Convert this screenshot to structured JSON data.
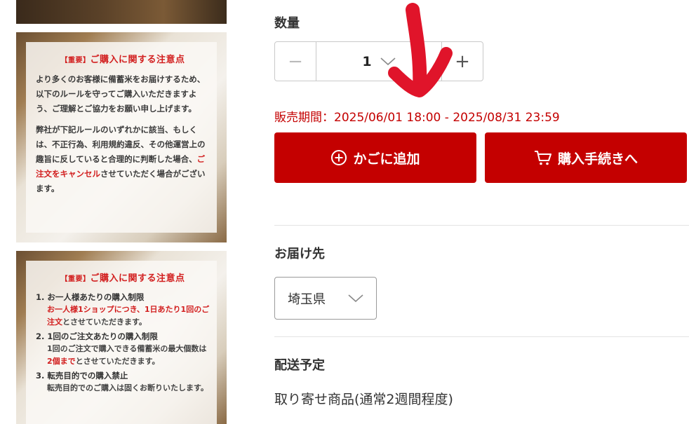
{
  "gallery": {
    "image1": {
      "title_tag": "【重要】",
      "title": "ご購入に関する注意点",
      "para1": "より多くのお客様に備蓄米をお届けするため、以下のルールを守ってご購入いただきますよう、ご理解とご協力をお願い申し上げます。",
      "para2_pre": "弊社が下記ルールのいずれかに該当、もしくは、不正行為、利用規約違反、その他運営上の趣旨に反していると合理的に判断した場合、",
      "para2_red": "ご注文をキャンセル",
      "para2_post": "させていただく場合がございます。"
    },
    "image2": {
      "title_tag": "【重要】",
      "title": "ご購入に関する注意点",
      "rules": [
        {
          "head": "1. お一人様あたりの購入制限",
          "body_red": "お一人様1ショップにつき、1日あたり1回のご注文",
          "body_post": "とさせていただきます。"
        },
        {
          "head": "2. 1回のご注文あたりの購入制限",
          "body_pre": "1回のご注文で購入できる備蓄米の最大個数は",
          "body_red": "2個まで",
          "body_post": "とさせていただきます。"
        },
        {
          "head": "3. 転売目的での購入禁止",
          "body_pre": "転売目的でのご購入は固くお断りいたします。"
        }
      ]
    }
  },
  "quantity": {
    "label": "数量",
    "value": "1",
    "minus": "−",
    "plus": "+"
  },
  "sale_period": "販売期間：2025/06/01 18:00 - 2025/08/31 23:59",
  "buttons": {
    "add_to_cart": "かごに追加",
    "checkout": "購入手続きへ"
  },
  "delivery": {
    "label": "お届け先",
    "prefecture": "埼玉県"
  },
  "shipping": {
    "label": "配送予定",
    "text": "取り寄せ商品(通常2週間程度)"
  },
  "colors": {
    "accent": "#c40000",
    "annotation": "#e0142a"
  },
  "icons": {
    "add": "plus-circle-icon",
    "cart": "cart-icon",
    "dropdown": "chevron-down-icon"
  }
}
